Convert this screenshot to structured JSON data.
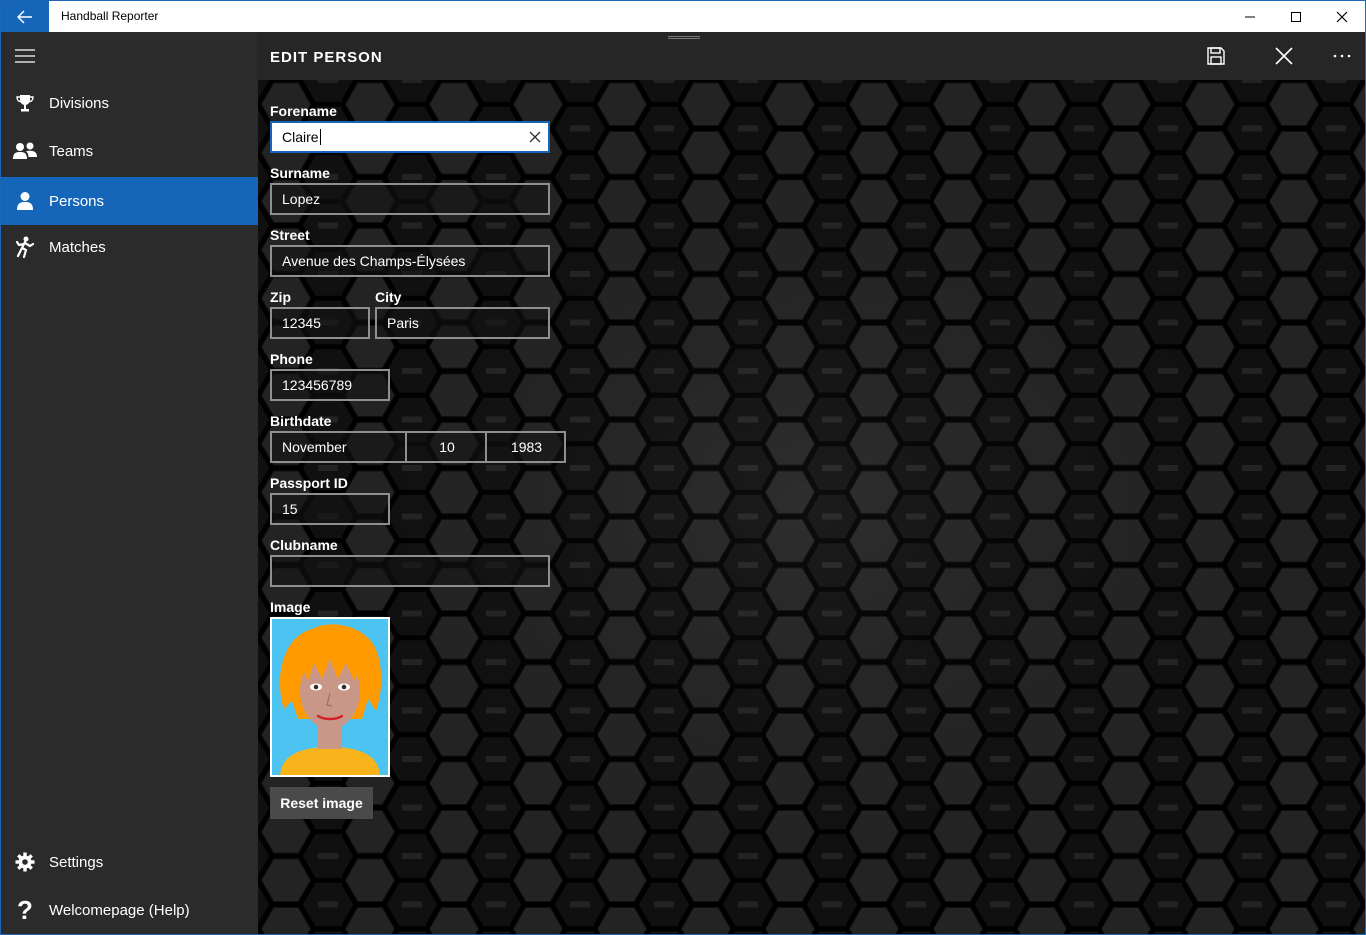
{
  "window": {
    "title": "Handball Reporter"
  },
  "titlebar_icons": {
    "back": "back-arrow-icon",
    "minimize": "minimize-icon",
    "maximize": "maximize-icon",
    "close": "close-icon"
  },
  "sidebar": {
    "items": [
      {
        "label": "Divisions",
        "icon": "trophy-icon"
      },
      {
        "label": "Teams",
        "icon": "group-icon"
      },
      {
        "label": "Persons",
        "icon": "person-icon",
        "selected": true
      },
      {
        "label": "Matches",
        "icon": "runner-icon"
      }
    ],
    "footer": [
      {
        "label": "Settings",
        "icon": "gear-icon"
      },
      {
        "label": "Welcomepage (Help)",
        "icon": "help-icon"
      }
    ]
  },
  "header": {
    "title": "EDIT PERSON"
  },
  "form": {
    "forename": {
      "label": "Forename",
      "value": "Claire"
    },
    "surname": {
      "label": "Surname",
      "value": "Lopez"
    },
    "street": {
      "label": "Street",
      "value": "Avenue des Champs-Élysées"
    },
    "zip": {
      "label": "Zip",
      "value": "12345"
    },
    "city": {
      "label": "City",
      "value": "Paris"
    },
    "phone": {
      "label": "Phone",
      "value": "123456789"
    },
    "birthdate": {
      "label": "Birthdate",
      "month": "November",
      "day": "10",
      "year": "1983"
    },
    "passport": {
      "label": "Passport ID",
      "value": "15"
    },
    "clubname": {
      "label": "Clubname",
      "value": ""
    },
    "image": {
      "label": "Image",
      "reset_label": "Reset image"
    }
  },
  "colors": {
    "accent": "#1565b8",
    "sidebar_bg": "#2b2b2b",
    "content_bg": "#141414",
    "avatar_bg": "#4cc3f0",
    "avatar_hair": "#ff9a00"
  }
}
